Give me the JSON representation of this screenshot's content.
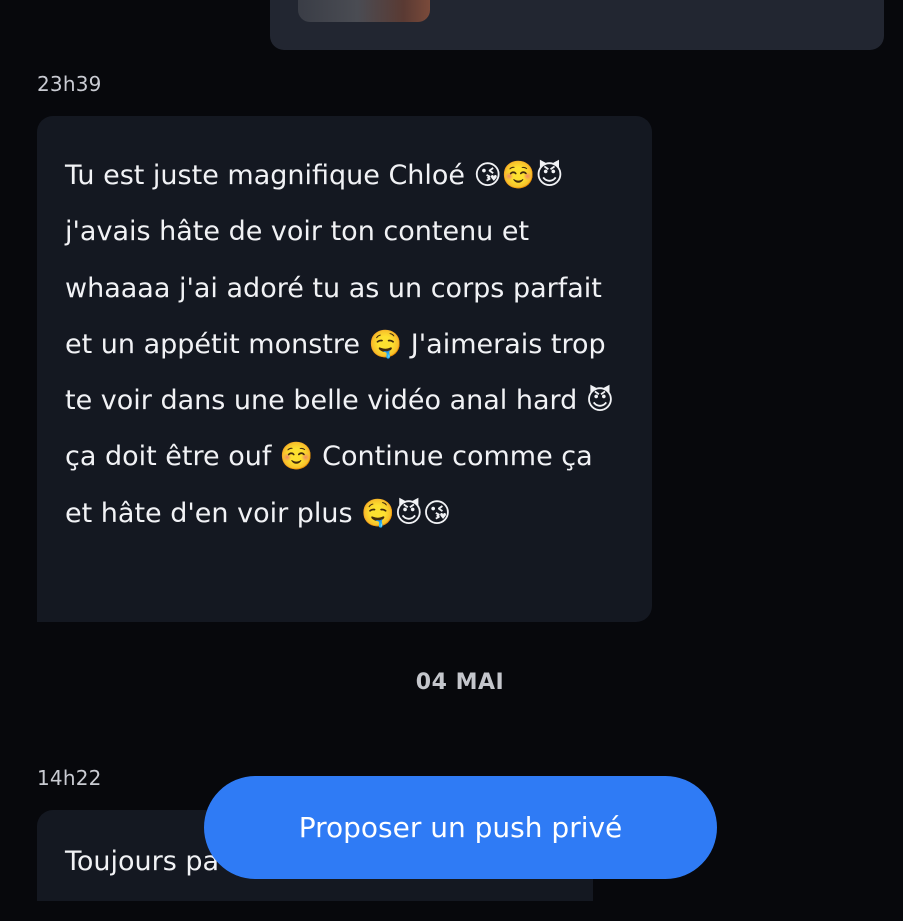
{
  "conversation": {
    "previous_sent": {
      "attachment_icon": "image-thumbnail-icon"
    },
    "message1": {
      "time": "23h39",
      "text": "Tu est juste magnifique Chloé 😘☺️😈 j'avais hâte de voir ton contenu et whaaaa j'ai adoré tu as un corps parfait et un appétit monstre 🤤 J'aimerais trop te voir dans une belle vidéo anal hard 😈 ça doit être ouf ☺️ Continue comme ça et hâte d'en voir plus 🤤😈😘"
    },
    "date_separator": "04 MAI",
    "message2": {
      "time": "14h22",
      "text": "Toujours pa"
    }
  },
  "actions": {
    "push_button_label": "Proposer un push privé"
  },
  "colors": {
    "background": "#07080c",
    "received_bubble": "#141821",
    "sent_bubble": "#222631",
    "accent": "#2f7bf5"
  }
}
